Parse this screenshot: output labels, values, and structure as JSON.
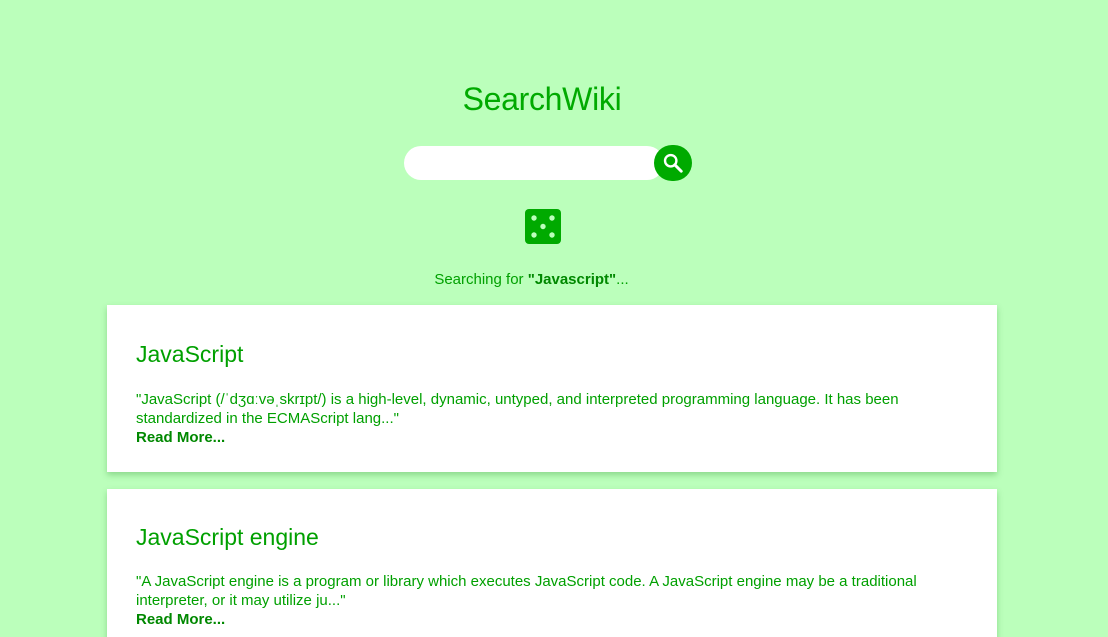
{
  "app": {
    "title": "SearchWiki"
  },
  "search": {
    "value": "",
    "placeholder": "",
    "button_icon": "search-icon",
    "random_icon": "dice-five-icon"
  },
  "status": {
    "prefix": "Searching for ",
    "query": "\"Javascript\"",
    "suffix": "..."
  },
  "results": [
    {
      "title": "JavaScript",
      "snippet": "\"JavaScript (/ˈdʒɑːvəˌskrɪpt/) is a high-level, dynamic, untyped, and interpreted programming language. It has been standardized in the ECMAScript lang...\"",
      "read_more": "Read More..."
    },
    {
      "title": "JavaScript engine",
      "snippet": "\"A JavaScript engine is a program or library which executes JavaScript code. A JavaScript engine may be a traditional interpreter, or it may utilize ju...\"",
      "read_more": "Read More..."
    }
  ],
  "colors": {
    "background": "#bbffbb",
    "accent": "#00aa00",
    "text": "#00a000",
    "card": "#ffffff"
  }
}
